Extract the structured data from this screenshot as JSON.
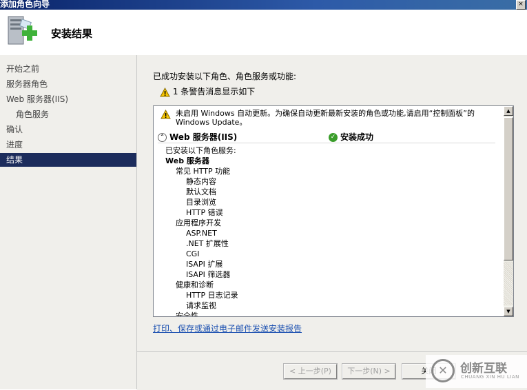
{
  "window": {
    "title": "添加角色向导",
    "close_glyph": "×"
  },
  "header": {
    "title": "安装结果",
    "icon": "server-add-icon"
  },
  "sidebar": {
    "items": [
      {
        "label": "开始之前",
        "active": false,
        "sub": false
      },
      {
        "label": "服务器角色",
        "active": false,
        "sub": false
      },
      {
        "label": "Web 服务器(IIS)",
        "active": false,
        "sub": false
      },
      {
        "label": "角色服务",
        "active": false,
        "sub": true
      },
      {
        "label": "确认",
        "active": false,
        "sub": false
      },
      {
        "label": "进度",
        "active": false,
        "sub": false
      },
      {
        "label": "结果",
        "active": true,
        "sub": false
      }
    ]
  },
  "main": {
    "intro": "已成功安装以下角色、角色服务或功能:",
    "warning_summary": "1 条警告消息显示如下",
    "panel": {
      "update_warning": "未启用 Windows 自动更新。为确保自动更新最新安装的角色或功能,请启用“控制面板”的 Windows Update。",
      "role_name": "Web 服务器(IIS)",
      "role_expander": "⌃",
      "result_status": "安装成功",
      "result_icon_glyph": "✓",
      "details": [
        {
          "text": "已安装以下角色服务:",
          "level": 0,
          "bold": false
        },
        {
          "text": "Web 服务器",
          "level": 0,
          "bold": true
        },
        {
          "text": "常见 HTTP 功能",
          "level": 1,
          "bold": false
        },
        {
          "text": "静态内容",
          "level": 2,
          "bold": false
        },
        {
          "text": "默认文档",
          "level": 2,
          "bold": false
        },
        {
          "text": "目录浏览",
          "level": 2,
          "bold": false
        },
        {
          "text": "HTTP 错误",
          "level": 2,
          "bold": false
        },
        {
          "text": "应用程序开发",
          "level": 1,
          "bold": false
        },
        {
          "text": "ASP.NET",
          "level": 2,
          "bold": false
        },
        {
          "text": ".NET 扩展性",
          "level": 2,
          "bold": false
        },
        {
          "text": "CGI",
          "level": 2,
          "bold": false
        },
        {
          "text": "ISAPI 扩展",
          "level": 2,
          "bold": false
        },
        {
          "text": "ISAPI 筛选器",
          "level": 2,
          "bold": false
        },
        {
          "text": "健康和诊断",
          "level": 1,
          "bold": false
        },
        {
          "text": "HTTP 日志记录",
          "level": 2,
          "bold": false
        },
        {
          "text": "请求监视",
          "level": 2,
          "bold": false
        },
        {
          "text": "安全性",
          "level": 1,
          "bold": false
        }
      ],
      "scroll_up_glyph": "▲",
      "scroll_down_glyph": "▼"
    },
    "report_link": "打印、保存或通过电子邮件发送安装报告"
  },
  "footer": {
    "prev_label": "< 上一步(P)",
    "next_label": "下一步(N) >",
    "close_label": "关闭"
  },
  "watermark": {
    "name": "创新互联",
    "sub": "CHUANG XIN HU LIAN",
    "logo_glyph": "✕"
  },
  "colors": {
    "active_nav": "#1c2c5c",
    "link": "#1a4fb0",
    "success": "#3a9d2a",
    "warning": "#f5c400"
  }
}
